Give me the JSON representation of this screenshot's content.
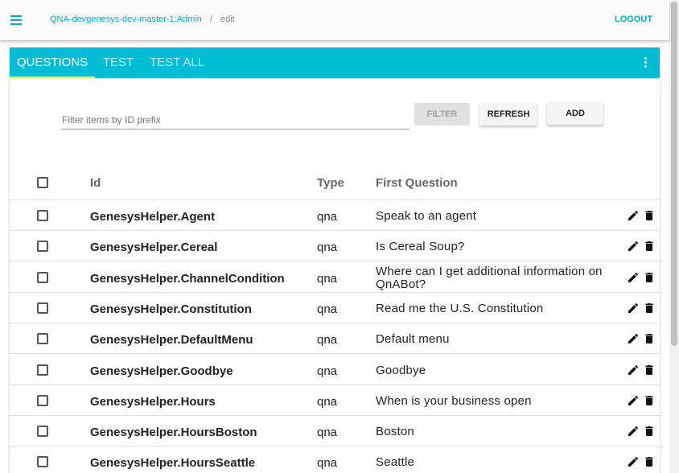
{
  "header": {
    "breadcrumb_link": "QNA-devgenesys-dev-master-1:Admin",
    "breadcrumb_separator": "/",
    "breadcrumb_current": "edit",
    "logout_label": "LOGOUT"
  },
  "tabs": [
    {
      "label": "QUESTIONS",
      "active": true
    },
    {
      "label": "TEST",
      "active": false
    },
    {
      "label": "TEST ALL",
      "active": false
    }
  ],
  "filter": {
    "placeholder": "Filter items by ID prefix",
    "value": "",
    "filter_label": "FILTER",
    "refresh_label": "REFRESH",
    "add_label": "ADD"
  },
  "table": {
    "headers": {
      "id": "Id",
      "type": "Type",
      "first_question": "First Question"
    },
    "rows": [
      {
        "id": "GenesysHelper.Agent",
        "type": "qna",
        "first_question": "Speak to an agent"
      },
      {
        "id": "GenesysHelper.Cereal",
        "type": "qna",
        "first_question": "Is Cereal Soup?"
      },
      {
        "id": "GenesysHelper.ChannelCondition",
        "type": "qna",
        "first_question": "Where can I get additional information on QnABot?"
      },
      {
        "id": "GenesysHelper.Constitution",
        "type": "qna",
        "first_question": "Read me the U.S. Constitution"
      },
      {
        "id": "GenesysHelper.DefaultMenu",
        "type": "qna",
        "first_question": "Default menu"
      },
      {
        "id": "GenesysHelper.Goodbye",
        "type": "qna",
        "first_question": "Goodbye"
      },
      {
        "id": "GenesysHelper.Hours",
        "type": "qna",
        "first_question": "When is your business open"
      },
      {
        "id": "GenesysHelper.HoursBoston",
        "type": "qna",
        "first_question": "Boston"
      },
      {
        "id": "GenesysHelper.HoursSeattle",
        "type": "qna",
        "first_question": "Seattle"
      }
    ]
  },
  "colors": {
    "accent": "#00bcd4",
    "link": "#00acc1",
    "tab_indicator": "#ffeb3b"
  },
  "icons": {
    "menu": "menu-icon",
    "more": "more-vert-icon",
    "edit": "pencil-icon",
    "delete": "trash-icon"
  }
}
